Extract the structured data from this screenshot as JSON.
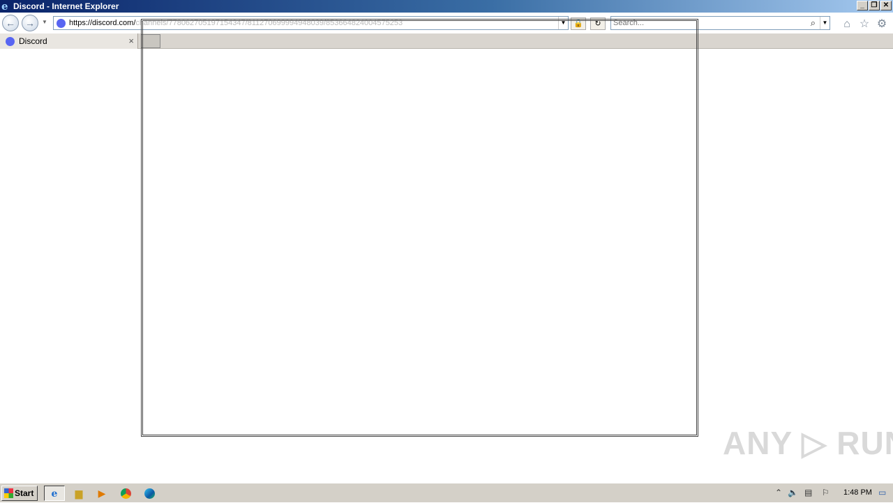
{
  "window": {
    "title": "Discord - Internet Explorer"
  },
  "address": {
    "url_visible": "https://discord.com/",
    "url_obscured": "channels/778062705197154347/811270699994948039/853664824004575253"
  },
  "search": {
    "placeholder": "Search..."
  },
  "tab": {
    "label": "Discord",
    "close": "×"
  },
  "watermark": "ANY ▷ RUN",
  "taskbar": {
    "start_label": "Start",
    "clock": "1:48 PM"
  },
  "colors": {
    "discord_blurple": "#5865f2",
    "title_gradient_start": "#0a246a"
  }
}
